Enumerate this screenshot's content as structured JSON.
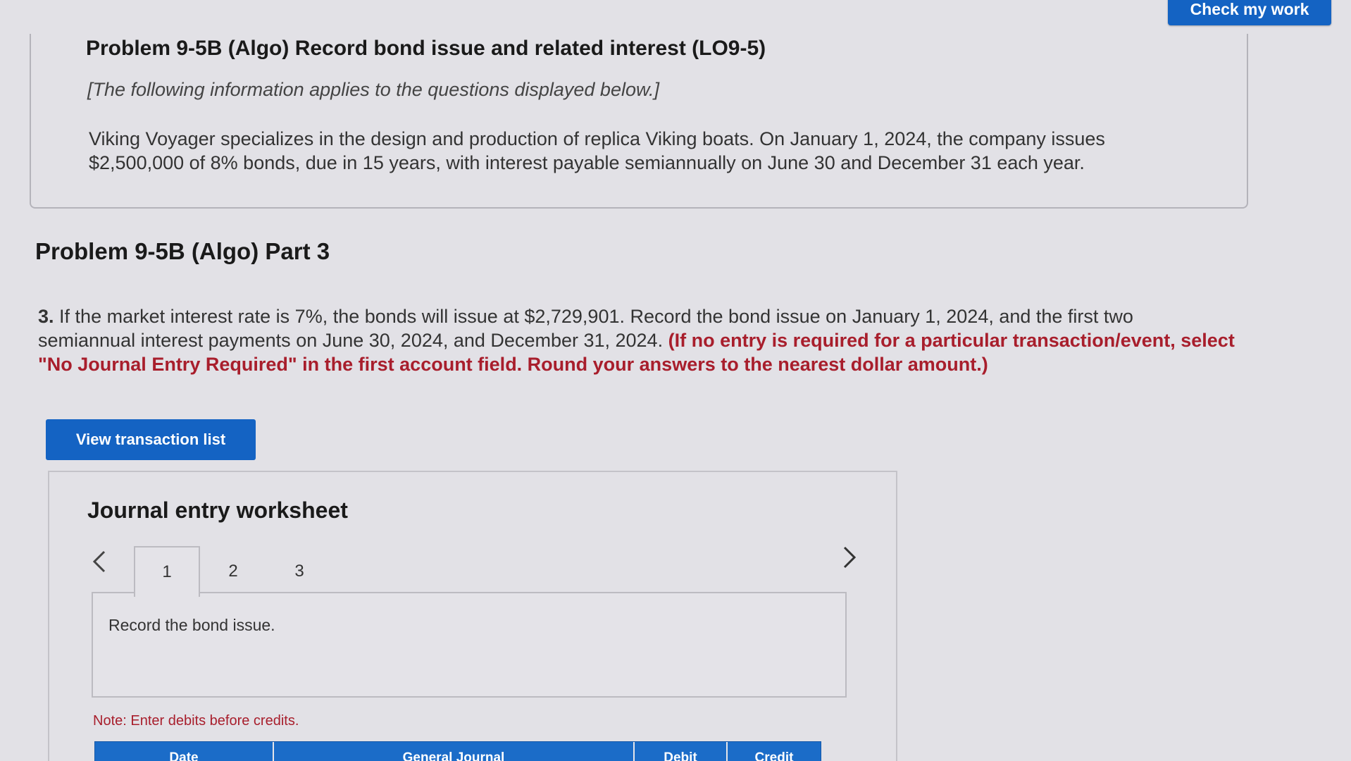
{
  "header": {
    "check_button": "Check my work"
  },
  "info": {
    "title": "Problem 9-5B (Algo) Record bond issue and related interest (LO9-5)",
    "note": "[The following information applies to the questions displayed below.]",
    "body": "Viking Voyager specializes in the design and production of replica Viking boats. On January 1, 2024, the company issues $2,500,000 of 8% bonds, due in 15 years, with interest payable semiannually on June 30 and December 31 each year."
  },
  "part": {
    "title": "Problem 9-5B (Algo) Part 3"
  },
  "question": {
    "number": "3.",
    "text": "If the market interest rate is 7%, the bonds will issue at $2,729,901. Record the bond issue on January 1, 2024, and the first two semiannual interest payments on June 30, 2024, and December 31, 2024.",
    "instruction": "(If no entry is required for a particular transaction/event, select \"No Journal Entry Required\" in the first account field. Round your answers to the nearest dollar amount.)"
  },
  "view_button": "View transaction list",
  "worksheet": {
    "title": "Journal entry worksheet",
    "prev_icon": "chevron-left-icon",
    "next_icon": "chevron-right-icon",
    "tabs": [
      {
        "label": "1",
        "active": true
      },
      {
        "label": "2",
        "active": false
      },
      {
        "label": "3",
        "active": false
      }
    ],
    "entry_text": "Record the bond issue.",
    "note": "Note: Enter debits before credits.",
    "columns": [
      "Date",
      "General Journal",
      "Debit",
      "Credit"
    ]
  },
  "colors": {
    "button_blue": "#1463c3",
    "instruction_red": "#a81e2c",
    "background": "#e2e1e6"
  }
}
